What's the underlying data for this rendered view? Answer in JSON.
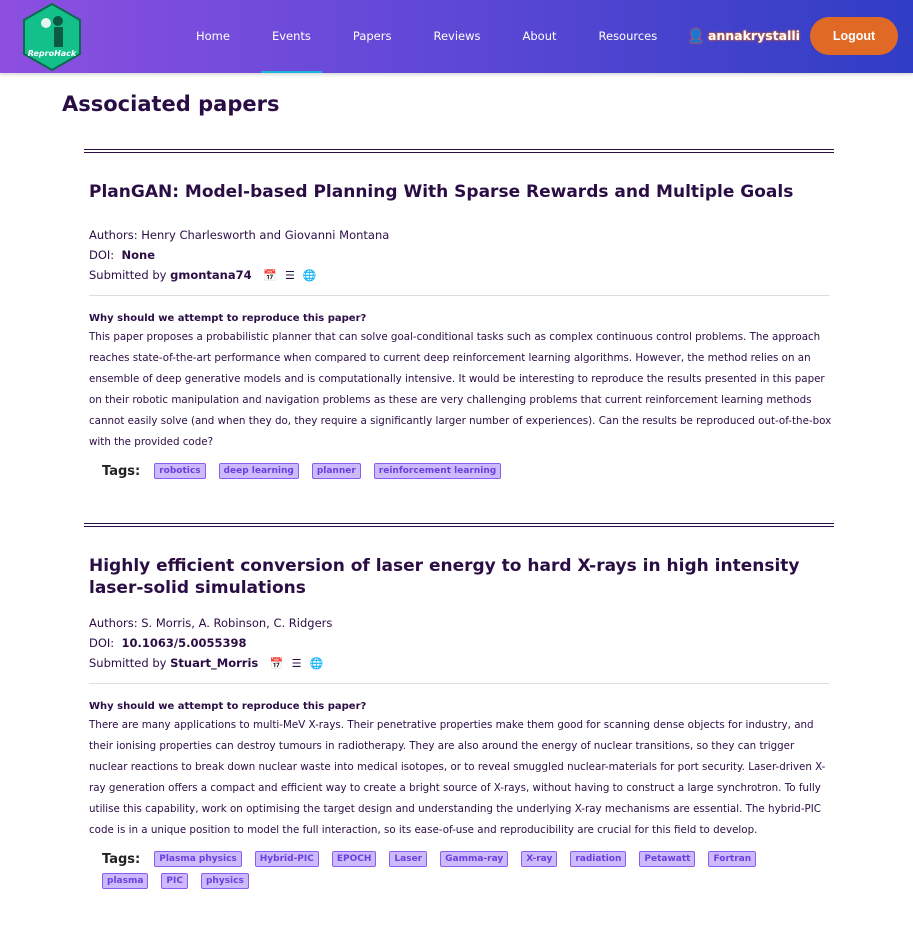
{
  "nav": {
    "logo_text": "ReproHack",
    "items": [
      "Home",
      "Events",
      "Papers",
      "Reviews",
      "About",
      "Resources"
    ],
    "active": "Events",
    "user": "annakrystalli",
    "logout": "Logout"
  },
  "page_title": "Associated papers",
  "labels": {
    "authors": "Authors:",
    "doi": "DOI:",
    "submitted_by": "Submitted by",
    "why": "Why should we attempt to reproduce this paper?",
    "tags": "Tags:"
  },
  "papers": [
    {
      "title": "PlanGAN: Model-based Planning With Sparse Rewards and Multiple Goals",
      "authors": "Henry Charlesworth and Giovanni Montana",
      "doi": "None",
      "submitter": "gmontana74",
      "why": "This paper proposes a probabilistic planner that can solve goal-conditional tasks such as complex continuous control problems. The approach reaches state-of-the-art performance when compared to current deep reinforcement learning algorithms. However, the method relies on an ensemble of deep generative models and is computationally intensive. It would be interesting to reproduce the results presented in this paper on their robotic manipulation and navigation problems as these are very challenging problems that current reinforcement learning methods cannot easily solve (and when they do, they require a significantly larger number of experiences). Can the results be reproduced out-of-the-box with the provided code?",
      "tags": [
        "robotics",
        "deep learning",
        "planner",
        "reinforcement learning"
      ]
    },
    {
      "title": "Highly efficient conversion of laser energy to hard X-rays in high intensity laser-solid simulations",
      "authors": "S. Morris, A. Robinson, C. Ridgers",
      "doi": "10.1063/5.0055398",
      "submitter": "Stuart_Morris",
      "why": "There are many applications to multi-MeV X-rays. Their penetrative properties make them good for scanning dense objects for industry, and their ionising properties can destroy tumours in radiotherapy. They are also around the energy of nuclear transitions, so they can trigger nuclear reactions to break down nuclear waste into medical isotopes, or to reveal smuggled nuclear-materials for port security. Laser-driven X-ray generation offers a compact and efficient way to create a bright source of X-rays, without having to construct a large synchrotron. To fully utilise this capability, work on optimising the target design and understanding the underlying X-ray mechanisms are essential. The hybrid-PIC code is in a unique position to model the full interaction, so its ease-of-use and reproducibility are crucial for this field to develop.",
      "tags": [
        "Plasma physics",
        "Hybrid-PIC",
        "EPOCH",
        "Laser",
        "Gamma-ray",
        "X-ray",
        "radiation",
        "Petawatt",
        "Fortran",
        "plasma",
        "PIC",
        "physics"
      ]
    }
  ]
}
